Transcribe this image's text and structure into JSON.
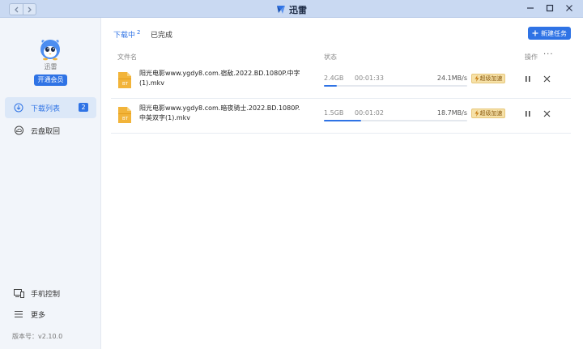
{
  "app": {
    "title": "迅雷"
  },
  "user": {
    "name": "迅雷",
    "vip_label": "开通会员"
  },
  "sidebar": {
    "items": [
      {
        "label": "下载列表",
        "badge": "2",
        "icon": "download-circle-icon"
      },
      {
        "label": "云盘取回",
        "icon": "cloud-icon"
      }
    ],
    "bottom_items": [
      {
        "label": "手机控制",
        "icon": "device-icon"
      },
      {
        "label": "更多",
        "icon": "menu-icon"
      }
    ],
    "version": "版本号：v2.10.0"
  },
  "tabs": [
    {
      "label": "下载中",
      "count": "2"
    },
    {
      "label": "已完成"
    }
  ],
  "toolbar": {
    "new_task_label": "新建任务"
  },
  "columns": {
    "name": "文件名",
    "status": "状态",
    "action": "操作",
    "more": "···"
  },
  "downloads": [
    {
      "name": "阳光电影www.ygdy8.com.宿敌.2022.BD.1080P.中字(1).mkv",
      "size": "2.4GB",
      "elapsed": "00:01:33",
      "speed": "24.1MB/s",
      "progress": 0.09,
      "accel_label": "超级加速",
      "file_tag": "BT"
    },
    {
      "name": "阳光电影www.ygdy8.com.暗夜骑士.2022.BD.1080P.中英双字(1).mkv",
      "size": "1.5GB",
      "elapsed": "00:01:02",
      "speed": "18.7MB/s",
      "progress": 0.26,
      "accel_label": "超级加速",
      "file_tag": "BT"
    }
  ],
  "colors": {
    "accent": "#2f73e5",
    "titlebar": "#c9d9f2",
    "sidebar": "#f2f5fa",
    "accel": "#f6e1a8",
    "file_icon": "#f2b43a"
  }
}
